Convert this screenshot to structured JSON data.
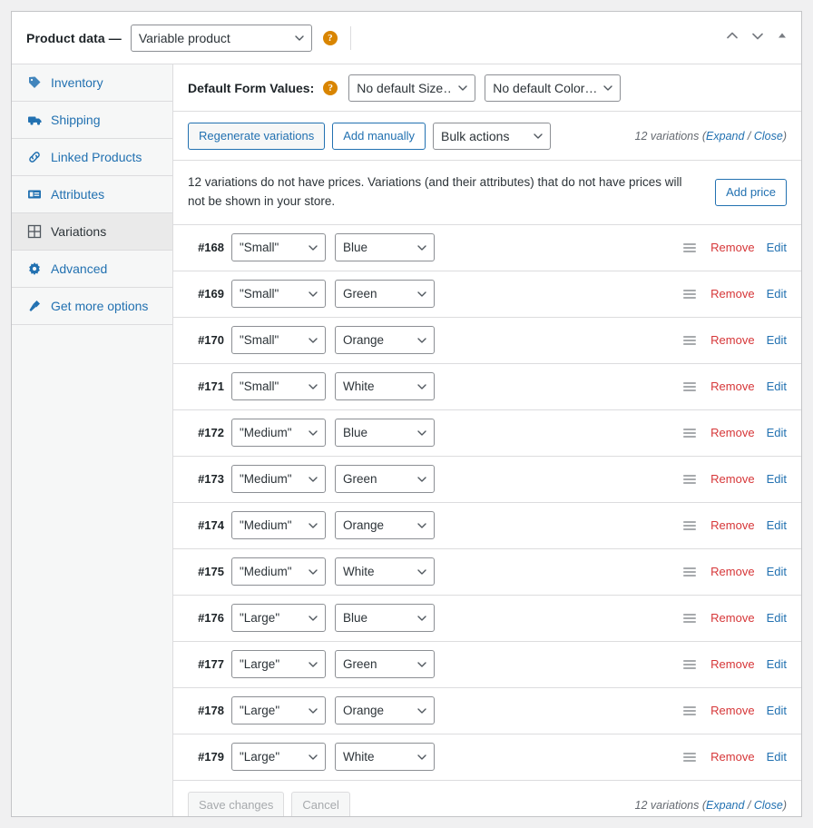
{
  "header": {
    "title": "Product data —",
    "product_type": "Variable product",
    "help_icon": "help-circle-icon",
    "move_up_icon": "chevron-up-icon",
    "move_down_icon": "chevron-down-icon",
    "collapse_icon": "triangle-up-icon"
  },
  "sidebar": {
    "items": [
      {
        "label": "Inventory",
        "icon": "tag-icon",
        "active": false
      },
      {
        "label": "Shipping",
        "icon": "truck-icon",
        "active": false
      },
      {
        "label": "Linked Products",
        "icon": "link-icon",
        "active": false
      },
      {
        "label": "Attributes",
        "icon": "list-view-icon",
        "active": false
      },
      {
        "label": "Variations",
        "icon": "grid-icon",
        "active": true
      },
      {
        "label": "Advanced",
        "icon": "gear-icon",
        "active": false
      },
      {
        "label": "Get more options",
        "icon": "plugin-icon",
        "active": false
      }
    ]
  },
  "defaults": {
    "label": "Default Form Values:",
    "help_icon": "help-circle-icon",
    "size_value": "No default Size…",
    "color_value": "No default Color…"
  },
  "toolbar": {
    "regenerate_label": "Regenerate variations",
    "add_manually_label": "Add manually",
    "bulk_actions_label": "Bulk actions",
    "count_text": "12 variations",
    "expand_label": "Expand",
    "separator": " / ",
    "close_label": "Close"
  },
  "notice": {
    "text": "12 variations do not have prices. Variations (and their attributes) that do not have prices will not be shown in your store.",
    "button_label": "Add price"
  },
  "rows": [
    {
      "id": "#168",
      "size": "\"Small\"",
      "color": "Blue",
      "remove": "Remove",
      "edit": "Edit"
    },
    {
      "id": "#169",
      "size": "\"Small\"",
      "color": "Green",
      "remove": "Remove",
      "edit": "Edit"
    },
    {
      "id": "#170",
      "size": "\"Small\"",
      "color": "Orange",
      "remove": "Remove",
      "edit": "Edit"
    },
    {
      "id": "#171",
      "size": "\"Small\"",
      "color": "White",
      "remove": "Remove",
      "edit": "Edit"
    },
    {
      "id": "#172",
      "size": "\"Medium\"",
      "color": "Blue",
      "remove": "Remove",
      "edit": "Edit"
    },
    {
      "id": "#173",
      "size": "\"Medium\"",
      "color": "Green",
      "remove": "Remove",
      "edit": "Edit"
    },
    {
      "id": "#174",
      "size": "\"Medium\"",
      "color": "Orange",
      "remove": "Remove",
      "edit": "Edit"
    },
    {
      "id": "#175",
      "size": "\"Medium\"",
      "color": "White",
      "remove": "Remove",
      "edit": "Edit"
    },
    {
      "id": "#176",
      "size": "\"Large\"",
      "color": "Blue",
      "remove": "Remove",
      "edit": "Edit"
    },
    {
      "id": "#177",
      "size": "\"Large\"",
      "color": "Green",
      "remove": "Remove",
      "edit": "Edit"
    },
    {
      "id": "#178",
      "size": "\"Large\"",
      "color": "Orange",
      "remove": "Remove",
      "edit": "Edit"
    },
    {
      "id": "#179",
      "size": "\"Large\"",
      "color": "White",
      "remove": "Remove",
      "edit": "Edit"
    }
  ],
  "footer": {
    "save_label": "Save changes",
    "cancel_label": "Cancel",
    "count_text": "12 variations",
    "expand_label": "Expand",
    "separator": " / ",
    "close_label": "Close"
  },
  "colors": {
    "link": "#2271b1",
    "danger": "#d63638",
    "help": "#d98500",
    "border": "#dcdcde",
    "panel_border": "#c3c4c7",
    "page_bg": "#f0f0f1"
  }
}
